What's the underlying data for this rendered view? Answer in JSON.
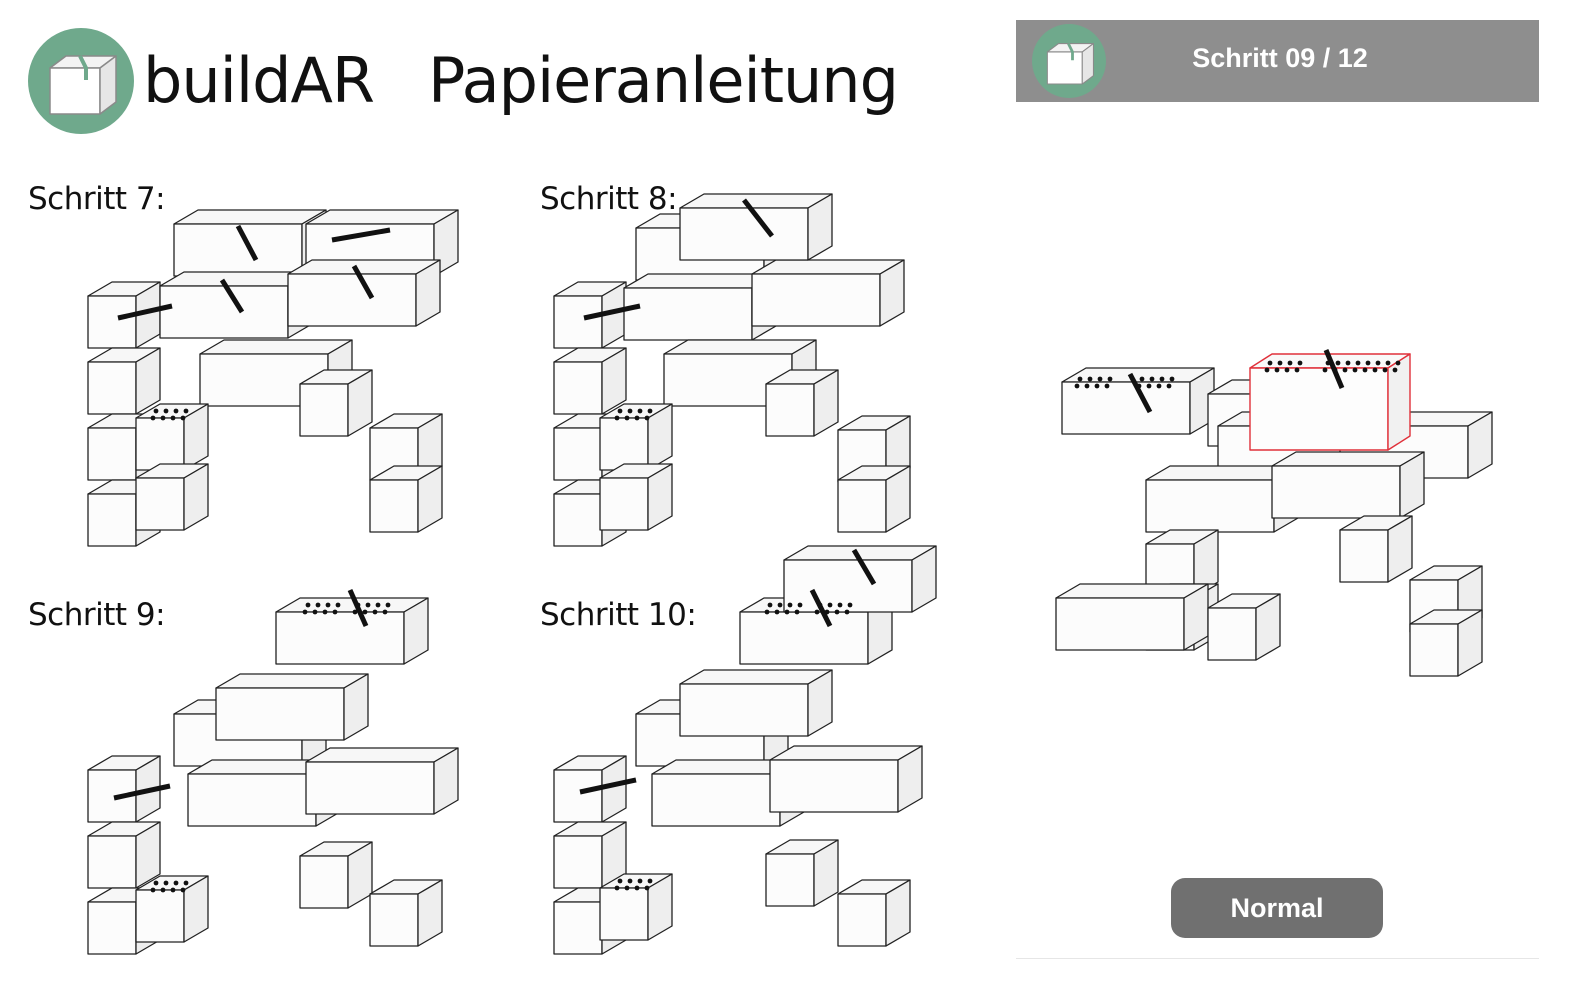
{
  "header": {
    "brand": "buildAR",
    "title": "Papieranleitung",
    "logo_icon": "box-logo-icon"
  },
  "manual": {
    "steps": [
      {
        "label": "Schritt 7:"
      },
      {
        "label": "Schritt 8:"
      },
      {
        "label": "Schritt 9:"
      },
      {
        "label": "Schritt 10:"
      }
    ]
  },
  "ar_panel": {
    "step_indicator": "Schritt 09 / 12",
    "mode_button": "Normal",
    "highlight_color": "#e0303a"
  },
  "colors": {
    "brand_green": "#6fa98c",
    "panel_gray": "#8e8e8e",
    "button_gray": "#707070"
  }
}
